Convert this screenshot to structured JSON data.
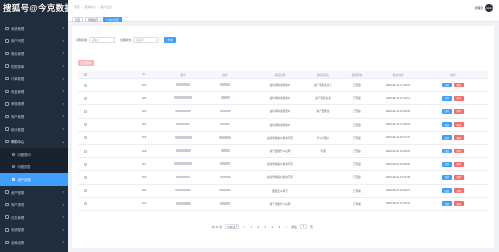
{
  "watermark": "搜狐号@今克数据",
  "sidebar": {
    "items": [
      {
        "label": "系统管理",
        "type": "item"
      },
      {
        "label": "用户列表",
        "type": "item"
      },
      {
        "label": "角色管理",
        "type": "item"
      },
      {
        "label": "权限菜单",
        "type": "item"
      },
      {
        "label": "订单数据",
        "type": "item"
      },
      {
        "label": "资金管理",
        "type": "item"
      },
      {
        "label": "审核管理",
        "type": "item"
      },
      {
        "label": "商户管理",
        "type": "item"
      },
      {
        "label": "统计数据",
        "type": "item"
      },
      {
        "label": "帮助中心",
        "type": "open"
      },
      {
        "label": "问题提问",
        "type": "sub"
      },
      {
        "label": "问题回答",
        "type": "sub"
      },
      {
        "label": "用户反馈",
        "type": "active"
      },
      {
        "label": "资产配置",
        "type": "item"
      },
      {
        "label": "商户提现",
        "type": "item"
      },
      {
        "label": "日志管理",
        "type": "item"
      },
      {
        "label": "系统配置",
        "type": "item"
      },
      {
        "label": "全局设置",
        "type": "item"
      }
    ]
  },
  "header": {
    "breadcrumb": [
      "首页",
      "帮助中心",
      "用户反馈"
    ],
    "tabs": [
      "首页",
      "问题提问",
      "用户反馈"
    ],
    "user_name": "管理员",
    "avatar_text": "Admin"
  },
  "filters": {
    "title_label": "问题标题",
    "title_placeholder": "请输入",
    "status_label": "处理状态",
    "status_placeholder": "请选择",
    "search_label": "查询"
  },
  "batch_delete_label": "批量删除",
  "table": {
    "headers": [
      "",
      "ID",
      "账号",
      "姓名",
      "反馈标题",
      "建议/意见",
      "处理状态",
      "提交时间",
      "操作"
    ],
    "rows": [
      {
        "id": "224",
        "title": "如何申请资金账户",
        "reply": "资产流程太多了",
        "status": "已回复",
        "time": "2020-06-14 17:19:02"
      },
      {
        "id": "223",
        "title": "如何申请资金账户",
        "reply": "资产流程太多",
        "status": "已回复",
        "time": "2020-06-14 17:12:12"
      },
      {
        "id": "222",
        "title": "如何申请资金账户",
        "reply": "资产要整改",
        "status": "已回复",
        "time": "2020-06-13 21:48:35"
      },
      {
        "id": "221",
        "title": "如何申请资金账户",
        "reply": "",
        "status": "已回复",
        "time": "2020-06-13 17:45:18"
      },
      {
        "id": "219",
        "title": "如何抢购客户提交不足",
        "reply": "什么问题?",
        "status": "已回复",
        "time": "2020-06-12 15:12:37"
      },
      {
        "id": "218",
        "title": "资产要做什么证明",
        "reply": "不懂",
        "status": "已回复",
        "time": "2020-06-02 21:05:25"
      },
      {
        "id": "217",
        "title": "如何抢购客户提交不足",
        "reply": "",
        "status": "已回复",
        "time": "2020-06-01 13:48:20"
      },
      {
        "id": "216",
        "title": "如何抢购客户提交不足",
        "reply": "",
        "status": "已回复",
        "time": "2020-06-01 13:31:08"
      },
      {
        "id": "215",
        "title": "数量怎么样写",
        "reply": "",
        "status": "已查看",
        "time": "2020-06-01 12:30:15"
      },
      {
        "id": "214",
        "title": "资产需要什么证明",
        "reply": "",
        "status": "已查看",
        "time": "2020-06-01 12:16:32"
      }
    ],
    "reply_label": "回复",
    "delete_label": "删除"
  },
  "pager": {
    "total": "共 47 条",
    "size": "10条/页",
    "prev": "<",
    "pages": [
      "1",
      "2",
      "3",
      "4",
      "5"
    ],
    "current": "1",
    "next": ">",
    "goto": "前往",
    "goto_value": "1",
    "page_suffix": "页"
  },
  "colors": {
    "sidebar": "#1f2d3d",
    "accent": "#409eff",
    "danger": "#f56c6c"
  }
}
